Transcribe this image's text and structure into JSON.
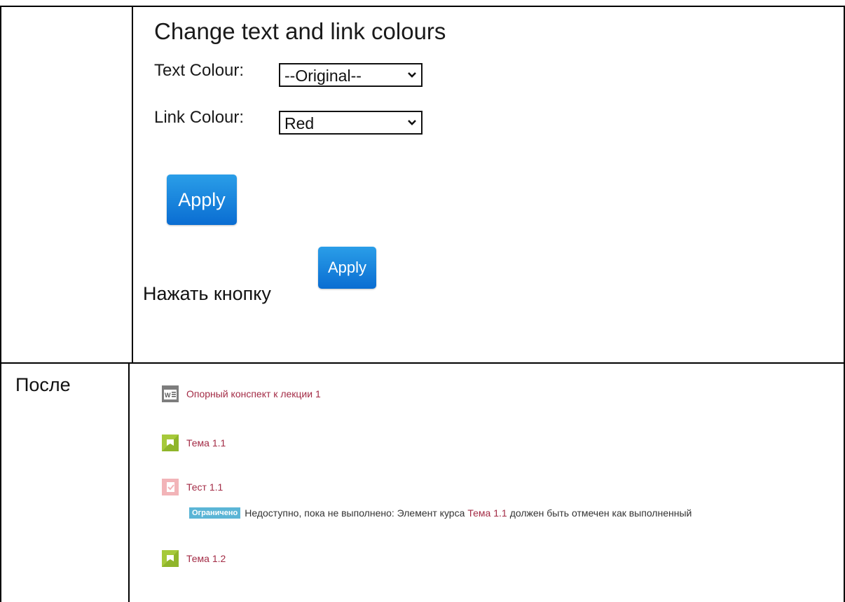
{
  "settings": {
    "heading": "Change text and link colours",
    "text_colour_label": "Text Colour:",
    "text_colour_value": "--Original--",
    "link_colour_label": "Link Colour:",
    "link_colour_value": "Red",
    "apply_label": "Apply",
    "instruction": "Нажать кнопку",
    "inline_apply_label": "Apply"
  },
  "after": {
    "label": "После",
    "items": [
      {
        "icon": "word-document-icon",
        "title": "Опорный конспект к лекции 1"
      },
      {
        "icon": "lesson-icon",
        "title": "Тема 1.1"
      },
      {
        "icon": "quiz-icon",
        "title": "Тест 1.1"
      },
      {
        "icon": "lesson-icon",
        "title": "Тема 1.2"
      }
    ],
    "restriction": {
      "badge": "Ограничено",
      "text_before": "Недоступно, пока не выполнено: Элемент курса",
      "link": "Тема 1.1",
      "text_after": "должен быть отмечен как выполненный"
    }
  },
  "colors": {
    "link": "#a32b45",
    "button": "#0a6dd2",
    "badge": "#5bb5d6"
  }
}
